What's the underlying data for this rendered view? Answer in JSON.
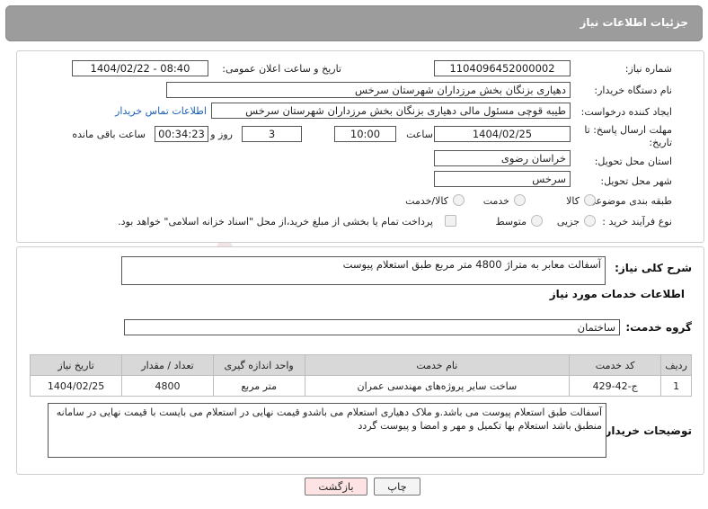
{
  "header": {
    "title": "جزئیات اطلاعات نیاز"
  },
  "form": {
    "need_number_label": "شماره نیاز:",
    "need_number": "1104096452000002",
    "announce_label": "تاریخ و ساعت اعلان عمومی:",
    "announce_value": "1404/02/22 - 08:40",
    "buyer_org_label": "نام دستگاه خریدار:",
    "buyer_org": "دهیاری بزنگان بخش مرزداران شهرستان سرخس",
    "requester_label": "ایجاد کننده درخواست:",
    "requester": "طیبه قوچی مسئول مالی دهیاری بزنگان بخش مرزداران شهرستان سرخس",
    "contact_link": "اطلاعات تماس خریدار",
    "deadline_label_1": "مهلت ارسال پاسخ: تا",
    "deadline_label_2": "تاریخ:",
    "deadline_date": "1404/02/25",
    "time_label": "ساعت",
    "deadline_time": "10:00",
    "days_value": "3",
    "days_label": "روز و",
    "remaining_time": "00:34:23",
    "remaining_label": "ساعت باقی مانده",
    "province_label": "استان محل تحویل:",
    "province": "خراسان رضوی",
    "city_label": "شهر محل تحویل:",
    "city": "سرخس",
    "category_label": "طبقه بندی موضوعی:",
    "category_options": [
      "کالا",
      "خدمت",
      "کالا/خدمت"
    ],
    "process_label": "نوع فرآیند خرید :",
    "process_options": [
      "جزیی",
      "متوسط"
    ],
    "payment_note": "پرداخت تمام یا بخشی از مبلغ خرید،از محل \"اسناد خزانه اسلامی\" خواهد بود."
  },
  "summary": {
    "label": "شرح کلی نیاز:",
    "text": "آسفالت معابر به متراژ 4800 متر مربع طبق استعلام پیوست"
  },
  "services": {
    "section_title": "اطلاعات خدمات مورد نیاز",
    "group_label": "گروه خدمت:",
    "group_value": "ساختمان",
    "columns": [
      "ردیف",
      "کد خدمت",
      "نام خدمت",
      "واحد اندازه گیری",
      "تعداد / مقدار",
      "تاریخ نیاز"
    ],
    "rows": [
      [
        "1",
        "ج-42-429",
        "ساخت سایر پروژه‌های مهندسی عمران",
        "متر مربع",
        "4800",
        "1404/02/25"
      ]
    ]
  },
  "notes": {
    "label": "توضیحات خریدار:",
    "text": "آسفالت طبق استعلام  پیوست می باشد.و ملاک  دهیاری استعلام  می باشدو قیمت نهایی در استعلام می بایست با قیمت نهایی در سامانه  منطبق باشد استعلام  بها  تکمیل  و مهر و امضا و پیوست  گردد"
  },
  "buttons": {
    "print": "چاپ",
    "back": "بازگشت"
  },
  "watermark": {
    "text": "AriaTender.net"
  },
  "colors": {
    "header_bg": "#9c9c9c",
    "back_button_bg": "#fde3e3",
    "link": "#1a5fb4"
  }
}
